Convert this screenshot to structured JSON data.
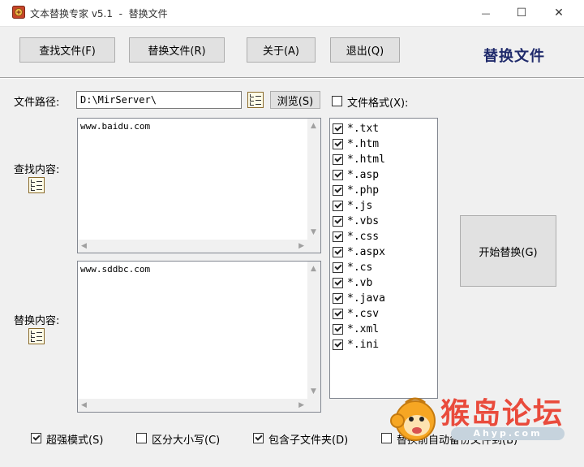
{
  "window": {
    "title": "文本替换专家 v5.1  -  替换文件",
    "minimize_glyph": "—",
    "maximize_glyph": "☐",
    "close_glyph": "✕"
  },
  "toolbar": {
    "find_files": "查找文件(F)",
    "replace_files": "替换文件(R)",
    "about": "关于(A)",
    "exit": "退出(Q)",
    "heading": "替换文件"
  },
  "path": {
    "label": "文件路径:",
    "value": "D:\\MirServer\\",
    "browse": "浏览(S)"
  },
  "file_format": {
    "label": "文件格式(X):",
    "checked": false,
    "extensions": [
      {
        "name": "*.txt",
        "checked": true
      },
      {
        "name": "*.htm",
        "checked": true
      },
      {
        "name": "*.html",
        "checked": true
      },
      {
        "name": "*.asp",
        "checked": true
      },
      {
        "name": "*.php",
        "checked": true
      },
      {
        "name": "*.js",
        "checked": true
      },
      {
        "name": "*.vbs",
        "checked": true
      },
      {
        "name": "*.css",
        "checked": true
      },
      {
        "name": "*.aspx",
        "checked": true
      },
      {
        "name": "*.cs",
        "checked": true
      },
      {
        "name": "*.vb",
        "checked": true
      },
      {
        "name": "*.java",
        "checked": true
      },
      {
        "name": "*.csv",
        "checked": true
      },
      {
        "name": "*.xml",
        "checked": true
      },
      {
        "name": "*.ini",
        "checked": true
      }
    ]
  },
  "find": {
    "label": "查找内容:",
    "value": "www.baidu.com"
  },
  "replace": {
    "label": "替换内容:",
    "value": "www.sddbc.com"
  },
  "start_button": "开始替换(G)",
  "options": [
    {
      "label": "超强模式(S)",
      "checked": true
    },
    {
      "label": "区分大小写(C)",
      "checked": false
    },
    {
      "label": "包含子文件夹(D)",
      "checked": true
    },
    {
      "label": "替换前自动备份文件到(B)",
      "checked": false
    }
  ],
  "watermark": {
    "text": "猴岛论坛",
    "url": "Ahyp.com"
  }
}
